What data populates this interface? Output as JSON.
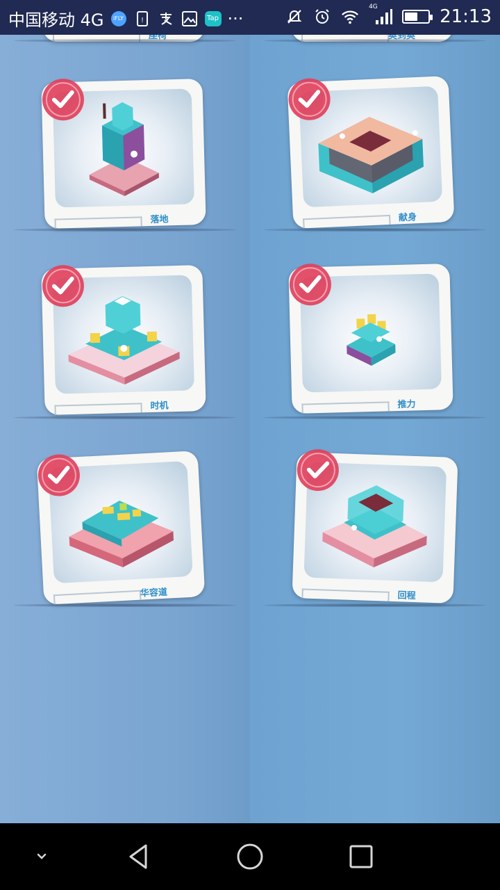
{
  "status_bar": {
    "carrier": "中国移动 4G",
    "ifly_badge": "iFLY",
    "tap_badge": "Tap",
    "overflow": "···",
    "network_label": "4G",
    "time": "21:13",
    "battery_level_pct": 55
  },
  "levels": [
    {
      "name": "落地",
      "completed": true
    },
    {
      "name": "献身",
      "completed": true
    },
    {
      "name": "时机",
      "completed": true
    },
    {
      "name": "推力",
      "completed": true
    },
    {
      "name": "华容道",
      "completed": true
    },
    {
      "name": "回程",
      "completed": true
    }
  ],
  "partial_top_titles": [
    "座椅",
    "奥到奥"
  ],
  "colors": {
    "status_bar_bg": "#202a52",
    "background_left": "#7aa5d1",
    "background_right": "#6ea2d0",
    "check_badge": "#e0415c",
    "title_text": "#2f8fc9"
  },
  "nav": {
    "back_icon": "back-triangle-icon",
    "home_icon": "home-circle-icon",
    "recents_icon": "recents-square-icon",
    "collapse_icon": "chevron-down-icon"
  }
}
